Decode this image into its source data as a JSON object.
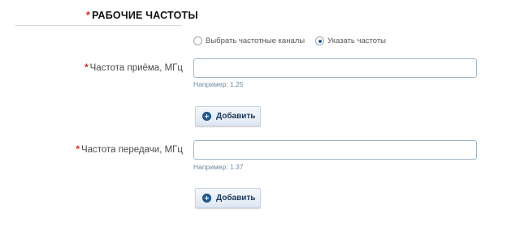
{
  "section": {
    "title": "РАБОЧИЕ ЧАСТОТЫ",
    "required_mark": "*"
  },
  "mode": {
    "options": [
      {
        "label": "Выбрать частотные каналы",
        "checked": false
      },
      {
        "label": "Указать частоты",
        "checked": true
      }
    ]
  },
  "receive": {
    "required_mark": "*",
    "label": "Частота приёма, МГц",
    "value": "",
    "hint": "Например: 1.25",
    "add_label": "Добавить"
  },
  "transmit": {
    "required_mark": "*",
    "label": "Частота передачи, МГц",
    "value": "",
    "hint": "Например: 1.37",
    "add_label": "Добавить"
  },
  "colors": {
    "required": "#d9241b",
    "accent": "#1f5f96",
    "input_border": "#9fb4c9"
  }
}
